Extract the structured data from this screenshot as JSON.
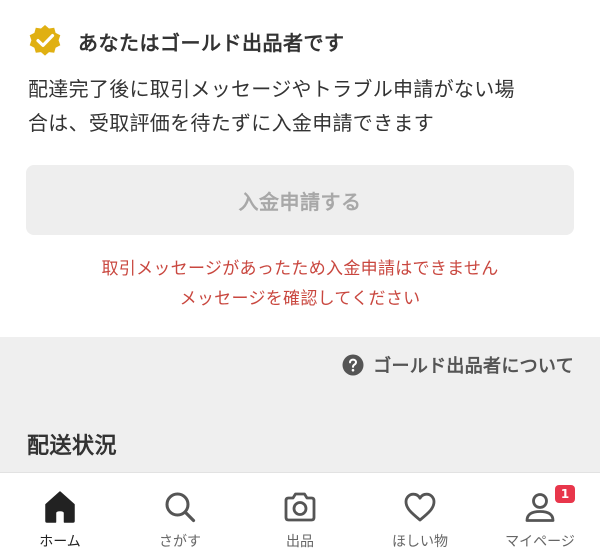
{
  "gold_status": {
    "title": "あなたはゴールド出品者です",
    "description_line1": "配達完了後に取引メッセージやトラブル申請がない場",
    "description_line2": "合は、受取評価を待たずに入金申請できます",
    "badge_color": "#e0b012"
  },
  "deposit_button": {
    "label": "入金申請する",
    "disabled": true
  },
  "error": {
    "line1": "取引メッセージがあったため入金申請はできません",
    "line2": "メッセージを確認してください",
    "color": "#c9473f"
  },
  "gold_info_link": {
    "label": "ゴールド出品者について",
    "icon": "help-circle-icon"
  },
  "shipping": {
    "title": "配送状況"
  },
  "tab_bar": {
    "tabs": [
      {
        "label": "ホーム",
        "icon": "home-icon",
        "active": true
      },
      {
        "label": "さがす",
        "icon": "search-icon",
        "active": false
      },
      {
        "label": "出品",
        "icon": "camera-icon",
        "active": false
      },
      {
        "label": "ほしい物",
        "icon": "heart-icon",
        "active": false
      },
      {
        "label": "マイページ",
        "icon": "user-icon",
        "active": false,
        "badge": "1"
      }
    ],
    "badge_color": "#e8364b"
  }
}
